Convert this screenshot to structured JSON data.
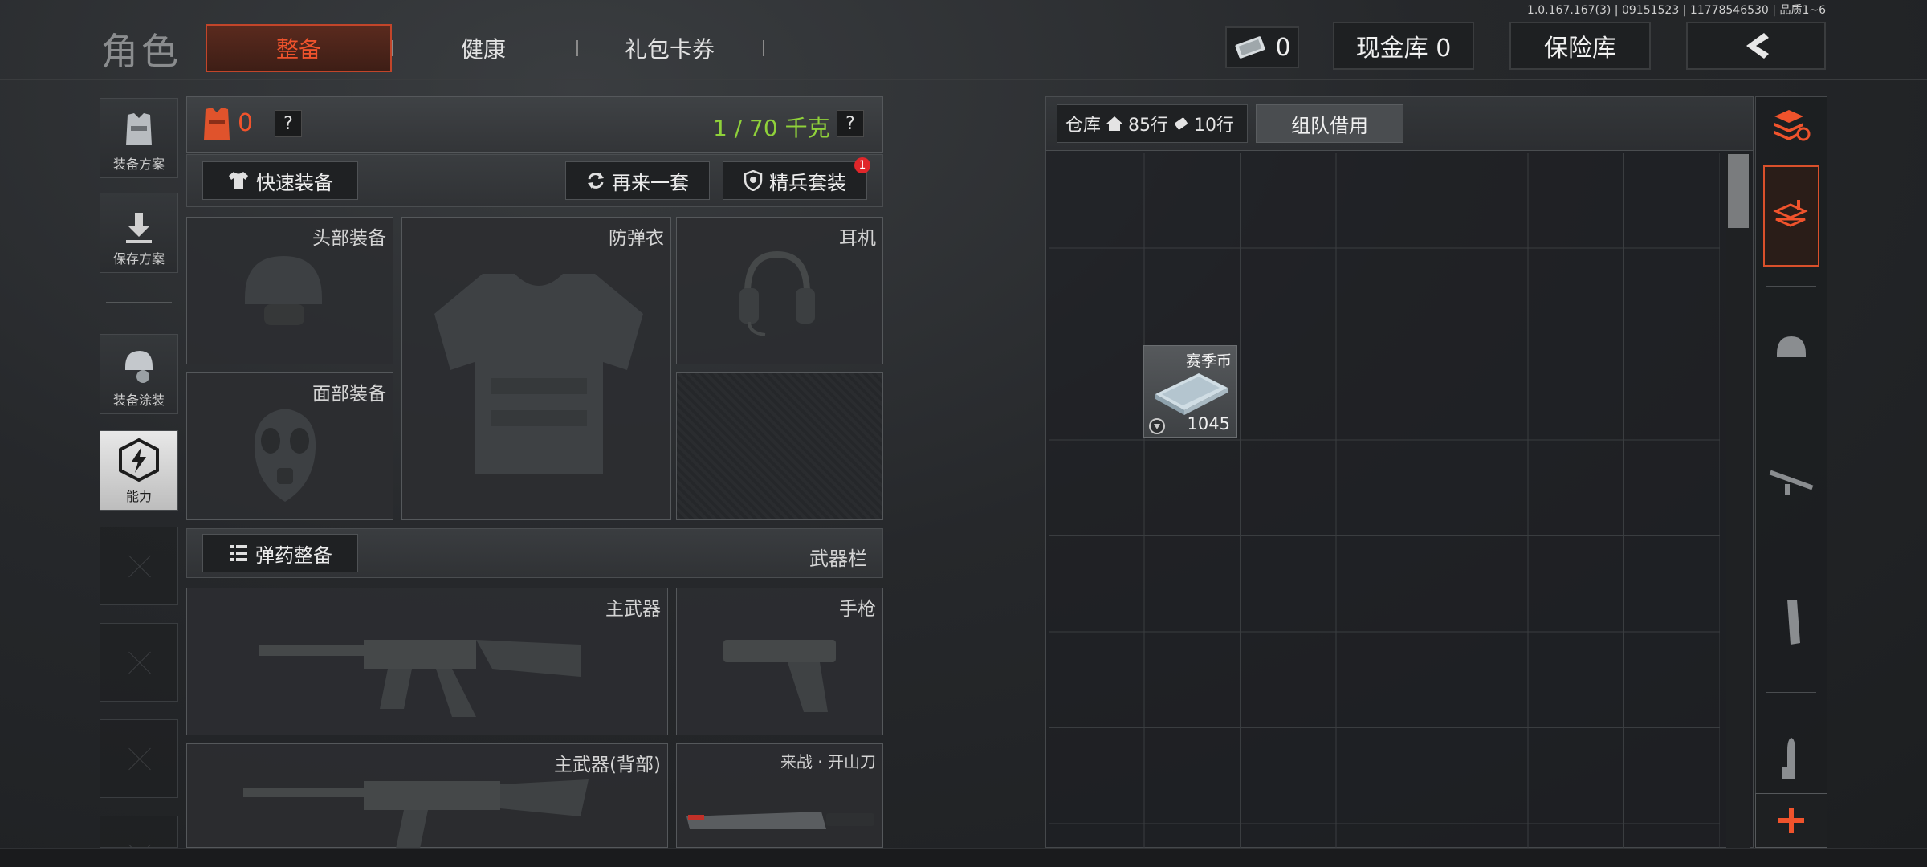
{
  "header": {
    "role_title": "角色",
    "tabs": [
      {
        "label": "整备",
        "active": true
      },
      {
        "label": "健康",
        "active": false
      },
      {
        "label": "礼包卡券",
        "active": false
      }
    ],
    "version": "1.0.167.167(3) | 09151523 | 11778546530 | 品质1~6",
    "currency_count": "0",
    "cash_vault": "现金库 0",
    "safe_box": "保险库"
  },
  "sidebar": {
    "items": [
      {
        "label": "装备方案",
        "icon": "vest-plan-icon"
      },
      {
        "label": "保存方案",
        "icon": "download-icon"
      },
      {
        "label": "装备涂装",
        "icon": "helmet-paint-icon"
      },
      {
        "label": "能力",
        "icon": "lightning-hex-icon",
        "active": true
      }
    ]
  },
  "equipment": {
    "vest_count": "0",
    "help": "?",
    "weight": "1 / 70 千克",
    "quick_equip": "快速装备",
    "again": "再来一套",
    "elite_set": "精兵套装",
    "elite_badge": "1",
    "slots": {
      "head": "头部装备",
      "armor": "防弹衣",
      "headset": "耳机",
      "face": "面部装备"
    },
    "ammo_equip": "弹药整备",
    "weapon_bar": "武器栏",
    "weapon_slots": {
      "primary": "主武器",
      "pistol": "手枪",
      "primary_back": "主武器(背部)",
      "melee": "来战 · 开山刀"
    }
  },
  "warehouse": {
    "label": "仓库",
    "rows_home": "85行",
    "rows_ticket": "10行",
    "team_borrow": "组队借用",
    "item": {
      "name": "赛季币",
      "count": "1045"
    }
  },
  "colors": {
    "accent": "#f0532c",
    "weight_green": "#8fd13a",
    "badge_red": "#e0262a"
  }
}
